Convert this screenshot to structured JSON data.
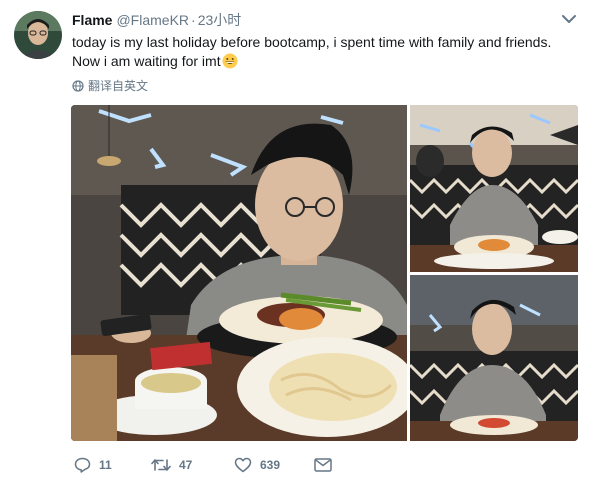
{
  "tweet": {
    "display_name": "Flame",
    "handle": "@FlameKR",
    "separator": "·",
    "time": "23小时",
    "text_line1": "today is my last holiday before bootcamp, i spent time with family and friends.",
    "text_line2": "Now i am waiting for imt",
    "emoji_icon": "grinning-face-emoji",
    "translate_label": "翻译自英文",
    "translate_icon": "globe-icon",
    "menu_icon": "chevron-down-icon"
  },
  "media": {
    "photos": [
      "photo-main",
      "photo-top-right",
      "photo-bottom-right"
    ]
  },
  "actions": {
    "reply_count": "11",
    "retweet_count": "47",
    "like_count": "639",
    "reply_icon": "reply-icon",
    "retweet_icon": "retweet-icon",
    "like_icon": "heart-icon",
    "dm_icon": "envelope-icon"
  },
  "colors": {
    "text_primary": "#14171a",
    "text_secondary": "#657786",
    "background": "#ffffff"
  }
}
